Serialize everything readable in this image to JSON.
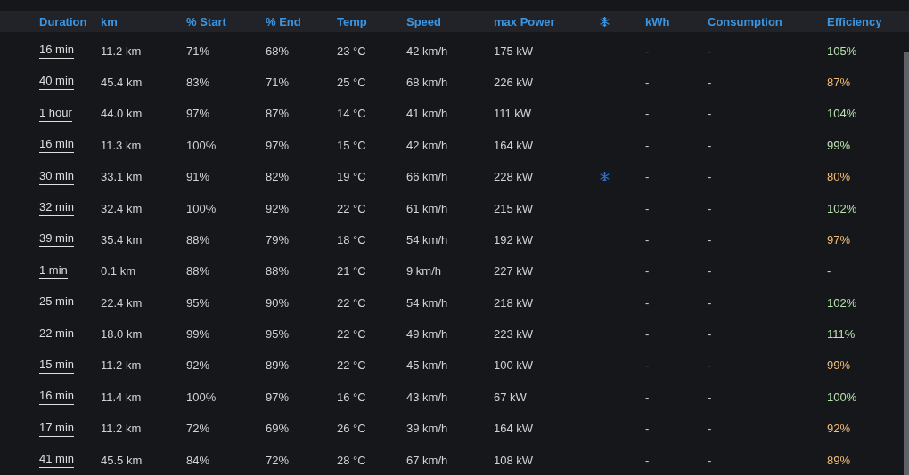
{
  "table": {
    "columns": [
      {
        "kind": "text",
        "label": "Duration"
      },
      {
        "kind": "text",
        "label": "km"
      },
      {
        "kind": "text",
        "label": "% Start"
      },
      {
        "kind": "text",
        "label": "% End"
      },
      {
        "kind": "text",
        "label": "Temp"
      },
      {
        "kind": "text",
        "label": "Speed"
      },
      {
        "kind": "text",
        "label": "max Power"
      },
      {
        "kind": "icon"
      },
      {
        "kind": "text",
        "label": "kWh"
      },
      {
        "kind": "text",
        "label": "Consumption"
      },
      {
        "kind": "text",
        "label": "Efficiency"
      }
    ],
    "rows": [
      {
        "duration": "16 min",
        "km": "11.2 km",
        "start": "71%",
        "end": "68%",
        "temp": "23 °C",
        "speed": "42 km/h",
        "max_power": "175 kW",
        "preconditioned": false,
        "kwh": "-",
        "consumption": "-",
        "efficiency": "105%",
        "color": "#b8e2ae"
      },
      {
        "duration": "40 min",
        "km": "45.4 km",
        "start": "83%",
        "end": "71%",
        "temp": "25 °C",
        "speed": "68 km/h",
        "max_power": "226 kW",
        "preconditioned": false,
        "kwh": "-",
        "consumption": "-",
        "efficiency": "87%",
        "color": "#f2bd78"
      },
      {
        "duration": "1 hour",
        "km": "44.0 km",
        "start": "97%",
        "end": "87%",
        "temp": "14 °C",
        "speed": "41 km/h",
        "max_power": "111 kW",
        "preconditioned": false,
        "kwh": "-",
        "consumption": "-",
        "efficiency": "104%",
        "color": "#b8e2ae"
      },
      {
        "duration": "16 min",
        "km": "11.3 km",
        "start": "100%",
        "end": "97%",
        "temp": "15 °C",
        "speed": "42 km/h",
        "max_power": "164 kW",
        "preconditioned": false,
        "kwh": "-",
        "consumption": "-",
        "efficiency": "99%",
        "color": "#b8e2ae"
      },
      {
        "duration": "30 min",
        "km": "33.1 km",
        "start": "91%",
        "end": "82%",
        "temp": "19 °C",
        "speed": "66 km/h",
        "max_power": "228 kW",
        "preconditioned": true,
        "kwh": "-",
        "consumption": "-",
        "efficiency": "80%",
        "color": "#f2bd78"
      },
      {
        "duration": "32 min",
        "km": "32.4 km",
        "start": "100%",
        "end": "92%",
        "temp": "22 °C",
        "speed": "61 km/h",
        "max_power": "215 kW",
        "preconditioned": false,
        "kwh": "-",
        "consumption": "-",
        "efficiency": "102%",
        "color": "#b8e2ae"
      },
      {
        "duration": "39 min",
        "km": "35.4 km",
        "start": "88%",
        "end": "79%",
        "temp": "18 °C",
        "speed": "54 km/h",
        "max_power": "192 kW",
        "preconditioned": false,
        "kwh": "-",
        "consumption": "-",
        "efficiency": "97%",
        "color": "#f2bd78"
      },
      {
        "duration": "1 min",
        "km": "0.1 km",
        "start": "88%",
        "end": "88%",
        "temp": "21 °C",
        "speed": "9 km/h",
        "max_power": "227 kW",
        "preconditioned": false,
        "kwh": "-",
        "consumption": "-",
        "efficiency": "-"
      },
      {
        "duration": "25 min",
        "km": "22.4 km",
        "start": "95%",
        "end": "90%",
        "temp": "22 °C",
        "speed": "54 km/h",
        "max_power": "218 kW",
        "preconditioned": false,
        "kwh": "-",
        "consumption": "-",
        "efficiency": "102%",
        "color": "#b8e2ae"
      },
      {
        "duration": "22 min",
        "km": "18.0 km",
        "start": "99%",
        "end": "95%",
        "temp": "22 °C",
        "speed": "49 km/h",
        "max_power": "223 kW",
        "preconditioned": false,
        "kwh": "-",
        "consumption": "-",
        "efficiency": "111%",
        "color": "#b8e2ae"
      },
      {
        "duration": "15 min",
        "km": "11.2 km",
        "start": "92%",
        "end": "89%",
        "temp": "22 °C",
        "speed": "45 km/h",
        "max_power": "100 kW",
        "preconditioned": false,
        "kwh": "-",
        "consumption": "-",
        "efficiency": "99%",
        "color": "#f2bd78"
      },
      {
        "duration": "16 min",
        "km": "11.4 km",
        "start": "100%",
        "end": "97%",
        "temp": "16 °C",
        "speed": "43 km/h",
        "max_power": "67 kW",
        "preconditioned": false,
        "kwh": "-",
        "consumption": "-",
        "efficiency": "100%",
        "color": "#b8e2ae"
      },
      {
        "duration": "17 min",
        "km": "11.2 km",
        "start": "72%",
        "end": "69%",
        "temp": "26 °C",
        "speed": "39 km/h",
        "max_power": "164 kW",
        "preconditioned": false,
        "kwh": "-",
        "consumption": "-",
        "efficiency": "92%",
        "color": "#f2bd78"
      },
      {
        "duration": "41 min",
        "km": "45.5 km",
        "start": "84%",
        "end": "72%",
        "temp": "28 °C",
        "speed": "67 km/h",
        "max_power": "108 kW",
        "preconditioned": false,
        "kwh": "-",
        "consumption": "-",
        "efficiency": "89%",
        "color": "#f2bd78"
      }
    ]
  }
}
